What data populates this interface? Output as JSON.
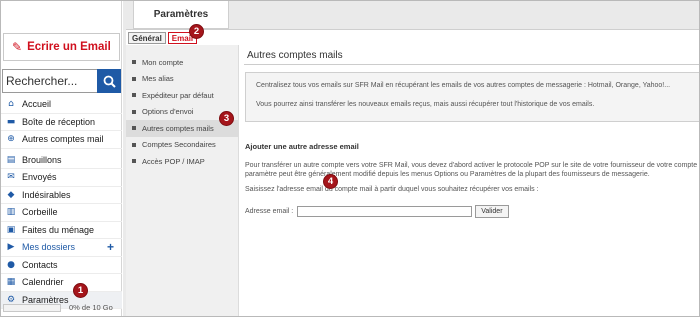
{
  "sidebar": {
    "compose_label": "Ecrire un Email",
    "search_placeholder": "Rechercher...",
    "items": [
      {
        "label": "Accueil",
        "icon": "home-icon",
        "glyph": "⌂"
      },
      {
        "label": "Boîte de réception",
        "icon": "inbox-icon",
        "glyph": "▬"
      },
      {
        "label": "Autres comptes mail",
        "icon": "add-account-icon",
        "glyph": "⊕"
      },
      {
        "label": "Brouillons",
        "icon": "drafts-icon",
        "glyph": "▤"
      },
      {
        "label": "Envoyés",
        "icon": "sent-icon",
        "glyph": "✉"
      },
      {
        "label": "Indésirables",
        "icon": "spam-shield-icon",
        "glyph": "◆"
      },
      {
        "label": "Corbeille",
        "icon": "trash-icon",
        "glyph": "▥"
      },
      {
        "label": "Faites du ménage",
        "icon": "cleanup-icon",
        "glyph": "▣"
      },
      {
        "label": "Mes dossiers",
        "icon": "folders-arrow-icon",
        "glyph": "▶"
      },
      {
        "label": "Contacts",
        "icon": "contacts-icon",
        "glyph": "●"
      },
      {
        "label": "Calendrier",
        "icon": "calendar-icon",
        "glyph": "▦"
      },
      {
        "label": "Paramètres",
        "icon": "gear-icon",
        "glyph": "⚙"
      }
    ],
    "quota_text": "0% de 10 Go",
    "quota_percent": 0
  },
  "main": {
    "top_tab": "Paramètres",
    "subtabs": [
      "Général",
      "Email"
    ],
    "active_subtab": "Email",
    "menu": [
      "Mon compte",
      "Mes alias",
      "Expéditeur par défaut",
      "Options d'envoi",
      "Autres comptes mails",
      "Comptes Secondaires",
      "Accès POP / IMAP"
    ],
    "active_menu": "Autres comptes mails"
  },
  "content": {
    "title": "Autres comptes mails",
    "info_1": "Centralisez tous vos emails sur SFR Mail en récupérant les emails de vos autres comptes de messagerie : Hotmail, Orange, Yahoo!...",
    "info_2": "Vous pourrez ainsi transférer les nouveaux emails reçus, mais aussi récupérer tout l'historique de vos emails.",
    "add_title": "Ajouter une autre adresse email",
    "para_line1": "Pour transférer un autre compte vers votre SFR Mail, vous devez d'abord activer le protocole POP sur le site de votre fournisseur de votre compte",
    "para_line2": "paramètre peut être généralement modifié depuis les menus Options ou Paramètres de la plupart des fournisseurs de messagerie.",
    "para3": "Saisissez l'adresse email du compte mail à partir duquel vous souhaitez récupérer vos emails :",
    "field_label": "Adresse email :",
    "field_value": "",
    "validate_label": "Valider"
  },
  "badges": [
    "1",
    "2",
    "3",
    "4"
  ],
  "colors": {
    "accent_red": "#d0101e",
    "brand_blue": "#1f5aa6",
    "badge_red": "#a5151b"
  }
}
